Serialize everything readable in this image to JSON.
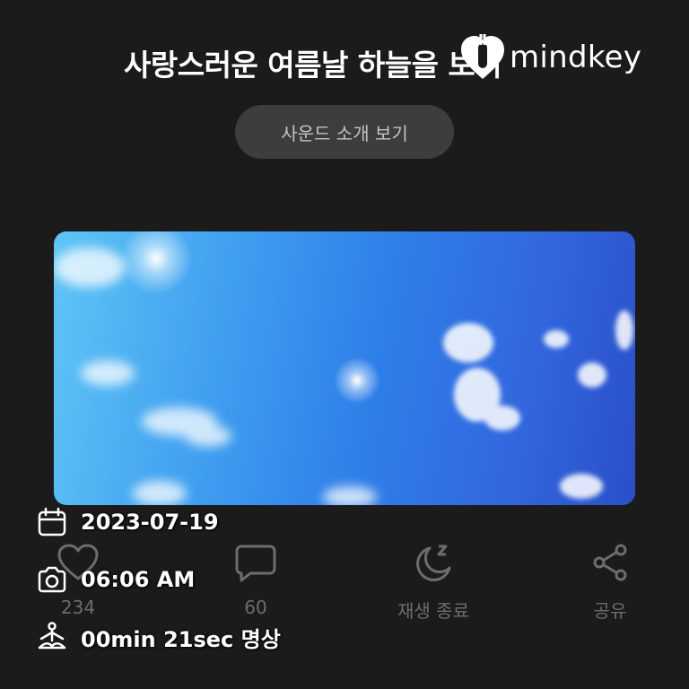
{
  "header": {
    "title": "사랑스러운 여름날 하늘을 보며",
    "intro_button_label": "사운드 소개 보기"
  },
  "watermark": {
    "text": "mindkey",
    "icon": "heart-lock-icon"
  },
  "actions": [
    {
      "icon": "heart-icon",
      "label": "234"
    },
    {
      "icon": "comment-icon",
      "label": "60"
    },
    {
      "icon": "sleep-moon-icon",
      "label": "재생 종료"
    },
    {
      "icon": "share-icon",
      "label": "공유"
    }
  ],
  "overlay": {
    "date": "2023-07-19",
    "time": "06:06 AM",
    "duration": "00min 21sec 명상"
  },
  "colors": {
    "background": "#1b1b1c",
    "button_bg": "#3d3d3f",
    "muted_text": "#6d6d70"
  }
}
